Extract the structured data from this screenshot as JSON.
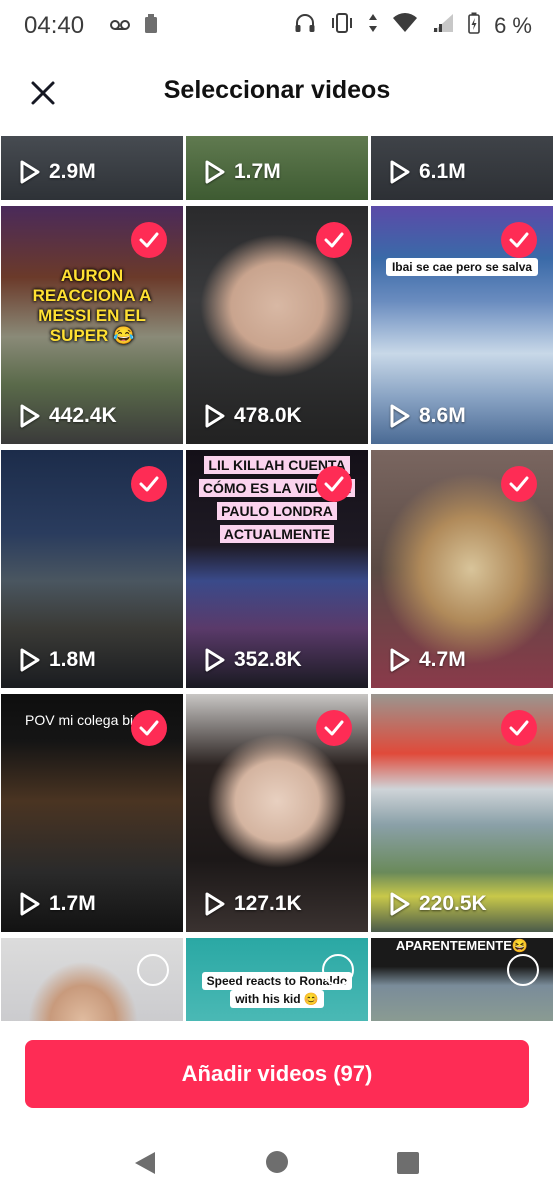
{
  "status_bar": {
    "time": "04:40",
    "battery_percent": "6 %"
  },
  "header": {
    "title": "Seleccionar videos"
  },
  "videos": [
    {
      "count": "2.9M"
    },
    {
      "count": "1.7M"
    },
    {
      "count": "6.1M"
    },
    {
      "count": "442.4K",
      "selected": true,
      "caption": "AURON REACCIONA A MESSI EN EL SUPER 😂"
    },
    {
      "count": "478.0K",
      "selected": true
    },
    {
      "count": "8.6M",
      "selected": true,
      "caption": "Ibai se cae pero se salva"
    },
    {
      "count": "1.8M",
      "selected": true
    },
    {
      "count": "352.8K",
      "selected": true,
      "caption": "LIL KILLAH CUENTA CÓMO ES LA VIDA DE PAULO LONDRA ACTUALMENTE"
    },
    {
      "count": "4.7M",
      "selected": true
    },
    {
      "count": "1.7M",
      "selected": true,
      "caption": "POV mi colega bip"
    },
    {
      "count": "127.1K",
      "selected": true
    },
    {
      "count": "220.5K",
      "selected": true
    },
    {
      "selected": false
    },
    {
      "selected": false,
      "caption": "Speed reacts to Ronaldo with his kid 😊"
    },
    {
      "selected": false,
      "caption": "APARENTEMENTE😆"
    }
  ],
  "footer": {
    "add_button": "Añadir videos (97)"
  },
  "colors": {
    "accent": "#fe2c55"
  }
}
